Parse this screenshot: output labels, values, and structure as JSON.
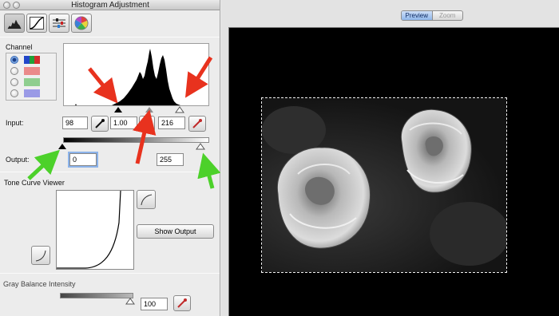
{
  "window": {
    "title": "Histogram Adjustment"
  },
  "toolbar": {
    "tools": [
      {
        "name": "histogram-tool-icon",
        "active": true
      },
      {
        "name": "tone-curve-tool-icon",
        "active": false
      },
      {
        "name": "brightness-contrast-tool-icon",
        "active": false
      },
      {
        "name": "color-balance-tool-icon",
        "active": false
      }
    ]
  },
  "channel": {
    "label": "Channel",
    "options": [
      {
        "id": "rgb",
        "selected": true,
        "colors": [
          "#2146c9",
          "#20a038",
          "#d22c2c"
        ]
      },
      {
        "id": "red",
        "selected": false,
        "colors": [
          "#ea8a8a"
        ]
      },
      {
        "id": "green",
        "selected": false,
        "colors": [
          "#8fce8f"
        ]
      },
      {
        "id": "blue",
        "selected": false,
        "colors": [
          "#9a9ae6"
        ]
      }
    ]
  },
  "input": {
    "label": "Input:",
    "shadow": "98",
    "midtone": "1.00",
    "highlight": "216"
  },
  "output": {
    "label": "Output:",
    "shadow": "0",
    "highlight": "255"
  },
  "tone_curve": {
    "label": "Tone Curve Viewer",
    "show_output_label": "Show Output"
  },
  "gray_balance": {
    "label": "Gray Balance Intensity",
    "value": "100"
  },
  "preview": {
    "tabs": [
      {
        "label": "Preview",
        "active": true
      },
      {
        "label": "Zoom",
        "active": false
      }
    ]
  },
  "colors": {
    "annotation_red": "#e8321e",
    "annotation_green": "#4cd12a",
    "selected_field_focus": "#8cb3ea"
  }
}
